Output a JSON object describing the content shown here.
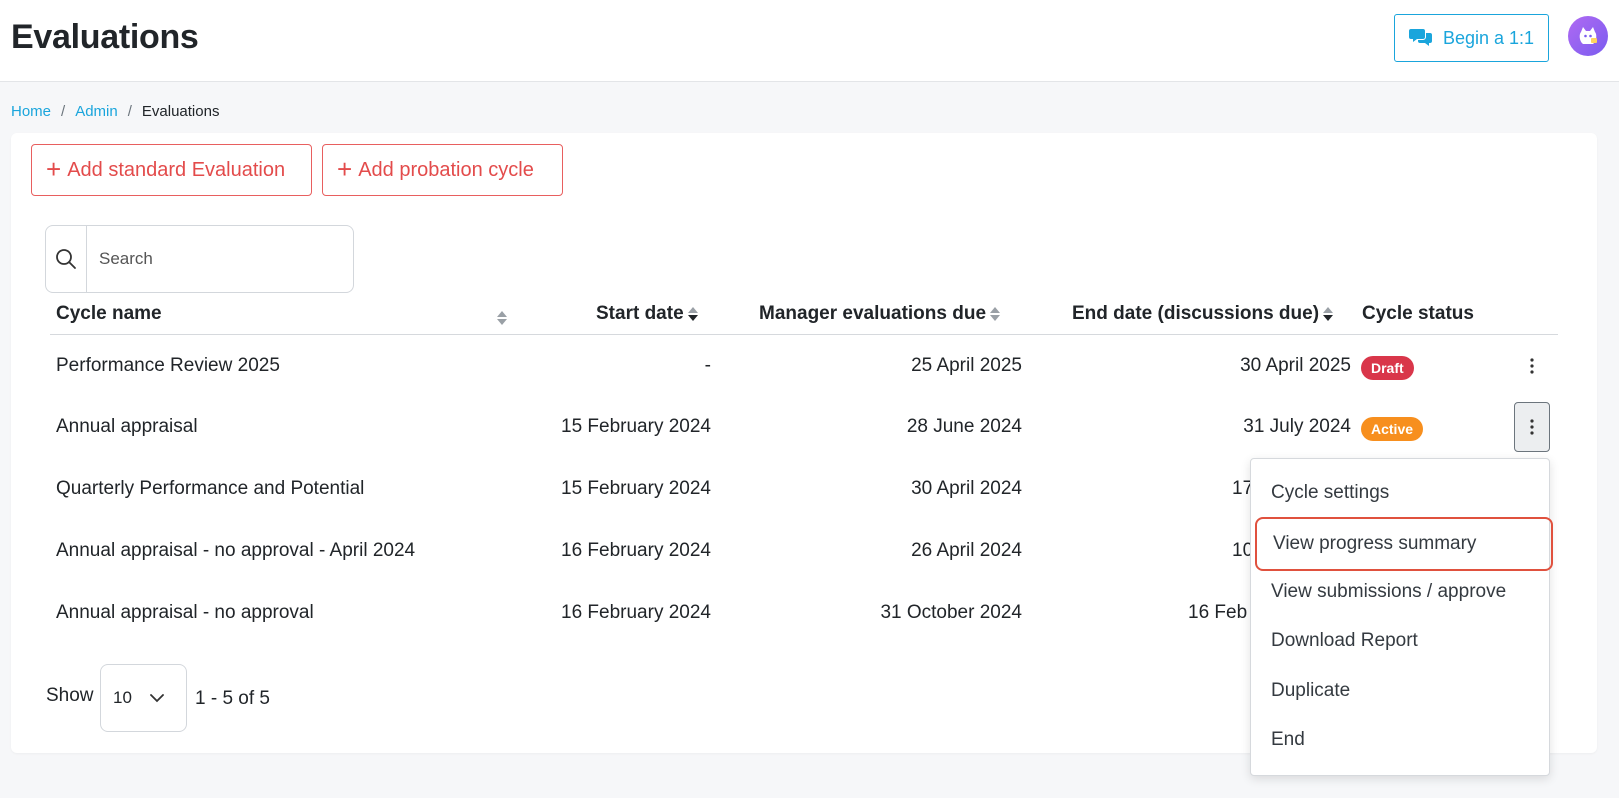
{
  "header": {
    "title": "Evaluations",
    "begin_label": "Begin a 1:1"
  },
  "breadcrumb": {
    "home": "Home",
    "admin": "Admin",
    "current": "Evaluations",
    "separator": "/"
  },
  "actions": {
    "add_standard": "Add standard Evaluation",
    "add_probation": "Add probation cycle",
    "plus": "+"
  },
  "search": {
    "placeholder": "Search"
  },
  "table": {
    "columns": {
      "cycle_name": "Cycle name",
      "start_date": "Start date",
      "manager_due": "Manager evaluations due",
      "end_date": "End date (discussions due)",
      "status": "Cycle status"
    },
    "rows": [
      {
        "name": "Performance Review 2025",
        "start": "-",
        "manager_due": "25 April 2025",
        "end": "30 April 2025",
        "status": "Draft"
      },
      {
        "name": "Annual appraisal",
        "start": "15 February 2024",
        "manager_due": "28 June 2024",
        "end": "31 July 2024",
        "status": "Active"
      },
      {
        "name": "Quarterly Performance and Potential",
        "start": "15 February 2024",
        "manager_due": "30 April 2024",
        "end": "17"
      },
      {
        "name": "Annual appraisal - no approval - April 2024",
        "start": "16 February 2024",
        "manager_due": "26 April 2024",
        "end": "10"
      },
      {
        "name": "Annual appraisal - no approval",
        "start": "16 February 2024",
        "manager_due": "31 October 2024",
        "end": "16 Feb"
      }
    ]
  },
  "menu": {
    "items": [
      "Cycle settings",
      "View progress summary",
      "View submissions / approve",
      "Download Report",
      "Duplicate",
      "End"
    ],
    "highlighted": "View progress summary"
  },
  "pagination": {
    "show_label": "Show",
    "page_size": "10",
    "info": "1 - 5 of 5"
  },
  "colors": {
    "accent_blue": "#1aa5dc",
    "danger_red": "#e34b4b",
    "draft_badge": "#d9364a",
    "active_badge": "#f78f1e",
    "highlight_outline": "#e0513e"
  },
  "icons": [
    "chat-bubbles-icon",
    "avatar-icon",
    "search-icon",
    "sort-icon",
    "kebab-icon",
    "chevron-down-icon"
  ]
}
